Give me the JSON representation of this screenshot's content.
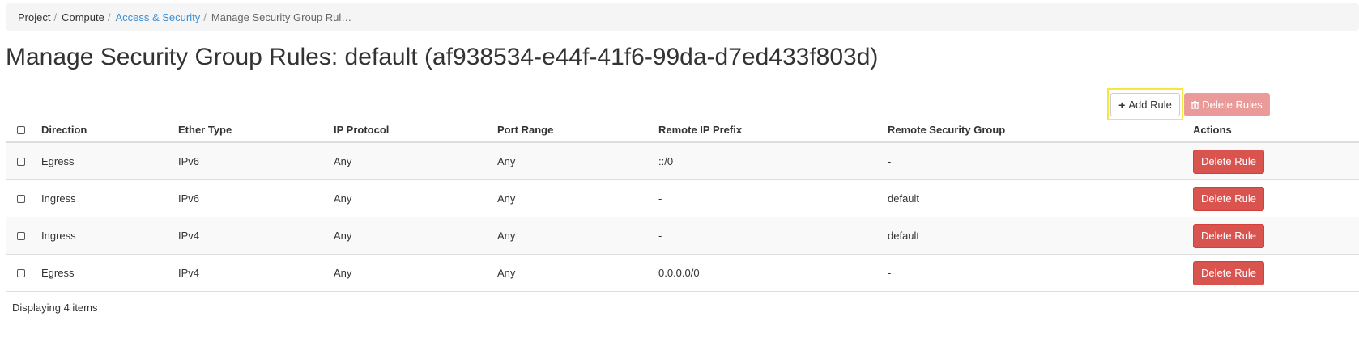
{
  "breadcrumb": [
    {
      "label": "Project"
    },
    {
      "label": "Compute"
    },
    {
      "label": "Access & Security"
    },
    {
      "label": "Manage Security Group Rul…"
    }
  ],
  "page": {
    "title": "Manage Security Group Rules: default (af938534-e44f-41f6-99da-d7ed433f803d)"
  },
  "toolbar": {
    "add_label": "Add Rule",
    "delete_label": "Delete Rules",
    "add_icon": "plus-icon",
    "delete_icon": "trash-icon"
  },
  "table": {
    "headers": [
      "Direction",
      "Ether Type",
      "IP Protocol",
      "Port Range",
      "Remote IP Prefix",
      "Remote Security Group",
      "Actions"
    ],
    "rows": [
      {
        "direction": "Egress",
        "ether_type": "IPv6",
        "ip_protocol": "Any",
        "port_range": "Any",
        "remote_ip_prefix": "::/0",
        "remote_security_group": "-",
        "action": "Delete Rule"
      },
      {
        "direction": "Ingress",
        "ether_type": "IPv6",
        "ip_protocol": "Any",
        "port_range": "Any",
        "remote_ip_prefix": "-",
        "remote_security_group": "default",
        "action": "Delete Rule"
      },
      {
        "direction": "Ingress",
        "ether_type": "IPv4",
        "ip_protocol": "Any",
        "port_range": "Any",
        "remote_ip_prefix": "-",
        "remote_security_group": "default",
        "action": "Delete Rule"
      },
      {
        "direction": "Egress",
        "ether_type": "IPv4",
        "ip_protocol": "Any",
        "port_range": "Any",
        "remote_ip_prefix": "0.0.0.0/0",
        "remote_security_group": "-",
        "action": "Delete Rule"
      }
    ],
    "footer": "Displaying 4 items"
  },
  "colors": {
    "link": "#3b8fd6",
    "danger": "#d9534f",
    "danger_disabled": "#ea9b99",
    "highlight": "#f5e642"
  }
}
